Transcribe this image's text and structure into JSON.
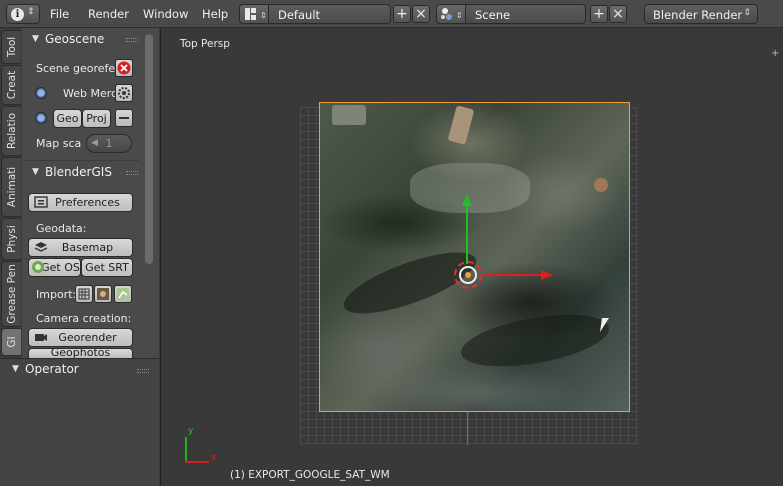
{
  "topbar": {
    "menu": [
      "File",
      "Render",
      "Window",
      "Help"
    ],
    "layout": "Default",
    "scene": "Scene",
    "engine": "Blender Render"
  },
  "tabs": [
    "Tool",
    "Creat",
    "Relatio",
    "Animati",
    "Physi",
    "Grease Pen",
    "GI"
  ],
  "geoscene": {
    "title": "Geoscene",
    "scene_georef": "Scene georefe",
    "crs": "Web Merc",
    "geo": "Geo",
    "proj": "Proj",
    "map_scale_label": "Map sca",
    "map_scale_value": "1"
  },
  "blendergis": {
    "title": "BlenderGIS",
    "preferences": "Preferences",
    "geodata_label": "Geodata:",
    "basemap": "Basemap",
    "get_osm": "Get OS",
    "get_srtm": "Get SRT",
    "import_label": "Import:",
    "camera_label": "Camera creation:",
    "georender": "Georender",
    "geophotos": "Geophotos"
  },
  "operator": {
    "title": "Operator"
  },
  "viewport": {
    "view_label": "Top Persp",
    "status": "(1) EXPORT_GOOGLE_SAT_WM",
    "axis_x": "x",
    "axis_y": "y"
  }
}
